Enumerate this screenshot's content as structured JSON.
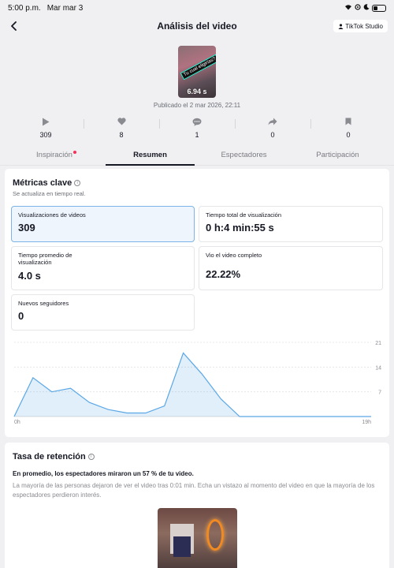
{
  "status_bar": {
    "time": "5:00 p.m.",
    "date": "Mar mar 3"
  },
  "header": {
    "title": "Análisis del video",
    "studio_button": "TikTok Studio"
  },
  "video": {
    "caption": "Tu cual eligirías?",
    "duration": "6.94 s",
    "published": "Publicado el 2 mar 2026, 22:11"
  },
  "stats": [
    {
      "icon": "play-icon",
      "value": "309"
    },
    {
      "icon": "heart-icon",
      "value": "8"
    },
    {
      "icon": "comment-icon",
      "value": "1"
    },
    {
      "icon": "share-icon",
      "value": "0"
    },
    {
      "icon": "bookmark-icon",
      "value": "0"
    }
  ],
  "tabs": [
    {
      "label": "Inspiración",
      "badge": true
    },
    {
      "label": "Resumen",
      "active": true
    },
    {
      "label": "Espectadores"
    },
    {
      "label": "Participación"
    }
  ],
  "key_metrics": {
    "title": "Métricas clave",
    "subtitle": "Se actualiza en tiempo real.",
    "items": [
      {
        "label": "Visualizaciones de videos",
        "value": "309",
        "selected": true
      },
      {
        "label": "Tiempo total de visualización",
        "value": "0 h:4 min:55 s"
      },
      {
        "label": "Tiempo promedio de visualización",
        "value": "4.0 s"
      },
      {
        "label": "Vio el video completo",
        "value": "22.22%"
      },
      {
        "label": "Nuevos seguidores",
        "value": "0"
      }
    ]
  },
  "chart_data": {
    "type": "area",
    "x": [
      0,
      1,
      2,
      3,
      4,
      5,
      6,
      7,
      8,
      9,
      10,
      11,
      12,
      13,
      14,
      15,
      16,
      17,
      18,
      19
    ],
    "values": [
      0,
      11,
      7,
      8,
      4,
      2,
      1,
      1,
      3,
      18,
      12,
      5,
      0,
      0,
      0,
      0,
      0,
      0,
      0,
      0
    ],
    "x_tick_labels": [
      "0h",
      "19h"
    ],
    "y_ticks": [
      7,
      14,
      21
    ],
    "ylim": [
      0,
      21
    ],
    "grid": true,
    "color": "#5aa7e6"
  },
  "retention": {
    "title": "Tasa de retención",
    "summary": "En promedio, los espectadores miraron un 57 % de tu video.",
    "description": "La mayoría de las personas dejaron de ver el video tras 0:01 min. Echa un vistazo al momento del video en que la mayoría de los espectadores perdieron interés."
  }
}
